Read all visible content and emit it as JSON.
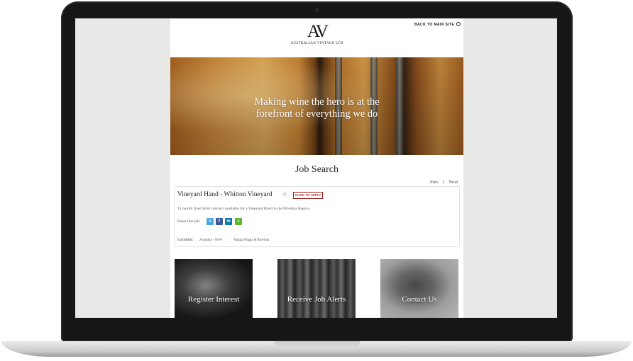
{
  "site": {
    "back_link": "BACK TO MAIN SITE",
    "logo_mark": "AV",
    "logo_text": "AUSTRALIAN VINTAGE LTD"
  },
  "hero": {
    "line1": "Making wine the hero is at the",
    "line2": "forefront of everything we do"
  },
  "search": {
    "title": "Job Search",
    "pager": {
      "prev": "Prev",
      "page": "1",
      "next": "Next"
    }
  },
  "job": {
    "title": "Vineyard Hand - Whitton Vineyard",
    "apply_label": "CLICK TO APPLY",
    "description": "12 month fixed term contract available for a Vineyard Hand in the Riverina Region.",
    "share_label": "Share this job:",
    "share_buttons": [
      {
        "label": "t",
        "icon": "twitter-icon",
        "color": "#4da7de"
      },
      {
        "label": "f",
        "icon": "facebook-icon",
        "color": "#3b5998"
      },
      {
        "label": "in",
        "icon": "linkedin-icon",
        "color": "#0e76a8"
      },
      {
        "label": "<",
        "icon": "share-icon",
        "color": "#5cb82e"
      }
    ],
    "location_label": "Location:",
    "location_country": "Australia - NSW",
    "location_region": "Wagga Wagga & Riverina"
  },
  "tiles": [
    {
      "label": "Register Interest"
    },
    {
      "label": "Receive Job Alerts"
    },
    {
      "label": "Contact Us"
    }
  ]
}
